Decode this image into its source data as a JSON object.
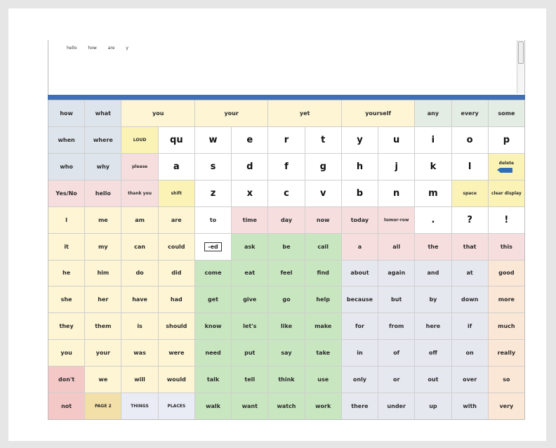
{
  "message": {
    "words": [
      "hello",
      "how",
      "are",
      "y"
    ]
  },
  "grid": {
    "cells": [
      {
        "label": "how",
        "color": "c-q"
      },
      {
        "label": "what",
        "color": "c-q"
      },
      {
        "label": "you",
        "color": "c-p",
        "span": 2
      },
      {
        "label": "your",
        "color": "c-p",
        "span": 2
      },
      {
        "label": "yet",
        "color": "c-p",
        "span": 2
      },
      {
        "label": "yourself",
        "color": "c-p",
        "span": 2
      },
      {
        "label": "any",
        "color": "c-gr"
      },
      {
        "label": "every",
        "color": "c-gr"
      },
      {
        "label": "some",
        "color": "c-gr"
      },
      {
        "label": "when",
        "color": "c-q"
      },
      {
        "label": "where",
        "color": "c-q"
      },
      {
        "label": "LOUD",
        "color": "c-y",
        "size": "tiny"
      },
      {
        "label": "qu",
        "color": "c-w",
        "size": "big"
      },
      {
        "label": "w",
        "color": "c-w",
        "size": "big"
      },
      {
        "label": "e",
        "color": "c-w",
        "size": "big"
      },
      {
        "label": "r",
        "color": "c-w",
        "size": "big"
      },
      {
        "label": "t",
        "color": "c-w",
        "size": "big"
      },
      {
        "label": "y",
        "color": "c-w",
        "size": "big"
      },
      {
        "label": "u",
        "color": "c-w",
        "size": "big"
      },
      {
        "label": "i",
        "color": "c-w",
        "size": "big"
      },
      {
        "label": "o",
        "color": "c-w",
        "size": "big"
      },
      {
        "label": "p",
        "color": "c-w",
        "size": "big"
      },
      {
        "label": "who",
        "color": "c-q"
      },
      {
        "label": "why",
        "color": "c-q"
      },
      {
        "label": "please",
        "color": "c-pk",
        "size": "tiny"
      },
      {
        "label": "a",
        "color": "c-w",
        "size": "big"
      },
      {
        "label": "s",
        "color": "c-w",
        "size": "big"
      },
      {
        "label": "d",
        "color": "c-w",
        "size": "big"
      },
      {
        "label": "f",
        "color": "c-w",
        "size": "big"
      },
      {
        "label": "g",
        "color": "c-w",
        "size": "big"
      },
      {
        "label": "h",
        "color": "c-w",
        "size": "big"
      },
      {
        "label": "j",
        "color": "c-w",
        "size": "big"
      },
      {
        "label": "k",
        "color": "c-w",
        "size": "big"
      },
      {
        "label": "l",
        "color": "c-w",
        "size": "big"
      },
      {
        "label": "delete",
        "color": "c-y",
        "size": "tiny",
        "icon": "delete-icon"
      },
      {
        "label": "Yes/No",
        "color": "c-pk"
      },
      {
        "label": "hello",
        "color": "c-pk"
      },
      {
        "label": "thank you",
        "color": "c-pk",
        "size": "tiny"
      },
      {
        "label": "shift",
        "color": "c-y",
        "size": "tiny"
      },
      {
        "label": "z",
        "color": "c-w",
        "size": "big"
      },
      {
        "label": "x",
        "color": "c-w",
        "size": "big"
      },
      {
        "label": "c",
        "color": "c-w",
        "size": "big"
      },
      {
        "label": "v",
        "color": "c-w",
        "size": "big"
      },
      {
        "label": "b",
        "color": "c-w",
        "size": "big"
      },
      {
        "label": "n",
        "color": "c-w",
        "size": "big"
      },
      {
        "label": "m",
        "color": "c-w",
        "size": "big"
      },
      {
        "label": "space",
        "color": "c-y",
        "size": "tiny"
      },
      {
        "label": "clear display",
        "color": "c-y",
        "size": "tiny"
      },
      {
        "label": "I",
        "color": "c-p"
      },
      {
        "label": "me",
        "color": "c-p"
      },
      {
        "label": "am",
        "color": "c-p"
      },
      {
        "label": "are",
        "color": "c-p"
      },
      {
        "label": "to",
        "color": "c-w"
      },
      {
        "label": "time",
        "color": "c-pk"
      },
      {
        "label": "day",
        "color": "c-pk"
      },
      {
        "label": "now",
        "color": "c-pk"
      },
      {
        "label": "today",
        "color": "c-pk"
      },
      {
        "label": "tomor-row",
        "color": "c-pk",
        "size": "tiny"
      },
      {
        "label": ".",
        "color": "c-w",
        "size": "big"
      },
      {
        "label": "?",
        "color": "c-w",
        "size": "big"
      },
      {
        "label": "!",
        "color": "c-w",
        "size": "big"
      },
      {
        "label": "it",
        "color": "c-p"
      },
      {
        "label": "my",
        "color": "c-p"
      },
      {
        "label": "can",
        "color": "c-p"
      },
      {
        "label": "could",
        "color": "c-p"
      },
      {
        "label": "-ed",
        "color": "c-w",
        "boxed": true
      },
      {
        "label": "ask",
        "color": "c-g"
      },
      {
        "label": "be",
        "color": "c-g"
      },
      {
        "label": "call",
        "color": "c-g"
      },
      {
        "label": "a",
        "color": "c-pk"
      },
      {
        "label": "all",
        "color": "c-pk"
      },
      {
        "label": "the",
        "color": "c-pk"
      },
      {
        "label": "that",
        "color": "c-pk"
      },
      {
        "label": "this",
        "color": "c-pk"
      },
      {
        "label": "he",
        "color": "c-p"
      },
      {
        "label": "him",
        "color": "c-p"
      },
      {
        "label": "do",
        "color": "c-p"
      },
      {
        "label": "did",
        "color": "c-p"
      },
      {
        "label": "come",
        "color": "c-g"
      },
      {
        "label": "eat",
        "color": "c-g"
      },
      {
        "label": "feel",
        "color": "c-g"
      },
      {
        "label": "find",
        "color": "c-g"
      },
      {
        "label": "about",
        "color": "c-l"
      },
      {
        "label": "again",
        "color": "c-l"
      },
      {
        "label": "and",
        "color": "c-l"
      },
      {
        "label": "at",
        "color": "c-l"
      },
      {
        "label": "good",
        "color": "c-o"
      },
      {
        "label": "she",
        "color": "c-p"
      },
      {
        "label": "her",
        "color": "c-p"
      },
      {
        "label": "have",
        "color": "c-p"
      },
      {
        "label": "had",
        "color": "c-p"
      },
      {
        "label": "get",
        "color": "c-g"
      },
      {
        "label": "give",
        "color": "c-g"
      },
      {
        "label": "go",
        "color": "c-g"
      },
      {
        "label": "help",
        "color": "c-g"
      },
      {
        "label": "because",
        "color": "c-l"
      },
      {
        "label": "but",
        "color": "c-l"
      },
      {
        "label": "by",
        "color": "c-l"
      },
      {
        "label": "down",
        "color": "c-l"
      },
      {
        "label": "more",
        "color": "c-o"
      },
      {
        "label": "they",
        "color": "c-p"
      },
      {
        "label": "them",
        "color": "c-p"
      },
      {
        "label": "is",
        "color": "c-p"
      },
      {
        "label": "should",
        "color": "c-p"
      },
      {
        "label": "know",
        "color": "c-g"
      },
      {
        "label": "let's",
        "color": "c-g"
      },
      {
        "label": "like",
        "color": "c-g"
      },
      {
        "label": "make",
        "color": "c-g"
      },
      {
        "label": "for",
        "color": "c-l"
      },
      {
        "label": "from",
        "color": "c-l"
      },
      {
        "label": "here",
        "color": "c-l"
      },
      {
        "label": "if",
        "color": "c-l"
      },
      {
        "label": "much",
        "color": "c-o"
      },
      {
        "label": "you",
        "color": "c-p"
      },
      {
        "label": "your",
        "color": "c-p"
      },
      {
        "label": "was",
        "color": "c-p"
      },
      {
        "label": "were",
        "color": "c-p"
      },
      {
        "label": "need",
        "color": "c-g"
      },
      {
        "label": "put",
        "color": "c-g"
      },
      {
        "label": "say",
        "color": "c-g"
      },
      {
        "label": "take",
        "color": "c-g"
      },
      {
        "label": "in",
        "color": "c-l"
      },
      {
        "label": "of",
        "color": "c-l"
      },
      {
        "label": "off",
        "color": "c-l"
      },
      {
        "label": "on",
        "color": "c-l"
      },
      {
        "label": "really",
        "color": "c-o"
      },
      {
        "label": "don't",
        "color": "c-r"
      },
      {
        "label": "we",
        "color": "c-p"
      },
      {
        "label": "will",
        "color": "c-p"
      },
      {
        "label": "would",
        "color": "c-p"
      },
      {
        "label": "talk",
        "color": "c-g"
      },
      {
        "label": "tell",
        "color": "c-g"
      },
      {
        "label": "think",
        "color": "c-g"
      },
      {
        "label": "use",
        "color": "c-g"
      },
      {
        "label": "only",
        "color": "c-l"
      },
      {
        "label": "or",
        "color": "c-l"
      },
      {
        "label": "out",
        "color": "c-l"
      },
      {
        "label": "over",
        "color": "c-l"
      },
      {
        "label": "so",
        "color": "c-o"
      },
      {
        "label": "not",
        "color": "c-r"
      },
      {
        "label": "PAGE 2",
        "color": "c-b",
        "size": "tiny"
      },
      {
        "label": "THINGS",
        "color": "c-lb",
        "size": "tiny"
      },
      {
        "label": "PLACES",
        "color": "c-lb",
        "size": "tiny"
      },
      {
        "label": "walk",
        "color": "c-g"
      },
      {
        "label": "want",
        "color": "c-g"
      },
      {
        "label": "watch",
        "color": "c-g"
      },
      {
        "label": "work",
        "color": "c-g"
      },
      {
        "label": "there",
        "color": "c-l"
      },
      {
        "label": "under",
        "color": "c-l"
      },
      {
        "label": "up",
        "color": "c-l"
      },
      {
        "label": "with",
        "color": "c-l"
      },
      {
        "label": "very",
        "color": "c-o"
      }
    ]
  }
}
